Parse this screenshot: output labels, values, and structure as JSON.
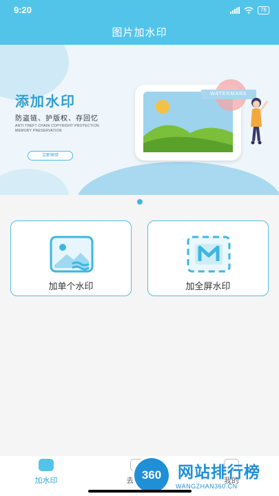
{
  "status": {
    "time": "9:20",
    "battery": "78"
  },
  "header": {
    "title": "图片加水印"
  },
  "banner": {
    "title": "添加水印",
    "subtitle": "防盗链、护版权、存回忆",
    "en_line1": "ANTI THEFT CHAIN  COPYRIGHT PROTECTION",
    "en_line2": "MEMORY PRESERVATION",
    "cta": "立即体验",
    "watermark_tag": "WATERMARK"
  },
  "cards": [
    {
      "label": "加单个水印",
      "icon": "single-watermark-icon"
    },
    {
      "label": "加全屏水印",
      "icon": "fullscreen-watermark-icon"
    }
  ],
  "tabs": [
    {
      "label": "加水印",
      "icon": "watermark-tab-icon",
      "active": true
    },
    {
      "label": "去水印",
      "icon": "remove-watermark-tab-icon"
    },
    {
      "label": "我的",
      "icon": "profile-tab-icon"
    }
  ],
  "overlay_logo": {
    "badge": "360",
    "text": "网站排行榜",
    "url": "WANGZHAN360.CN"
  },
  "colors": {
    "primary": "#52c4ea",
    "accent": "#2fa9d8",
    "card_border": "#52bedc"
  }
}
